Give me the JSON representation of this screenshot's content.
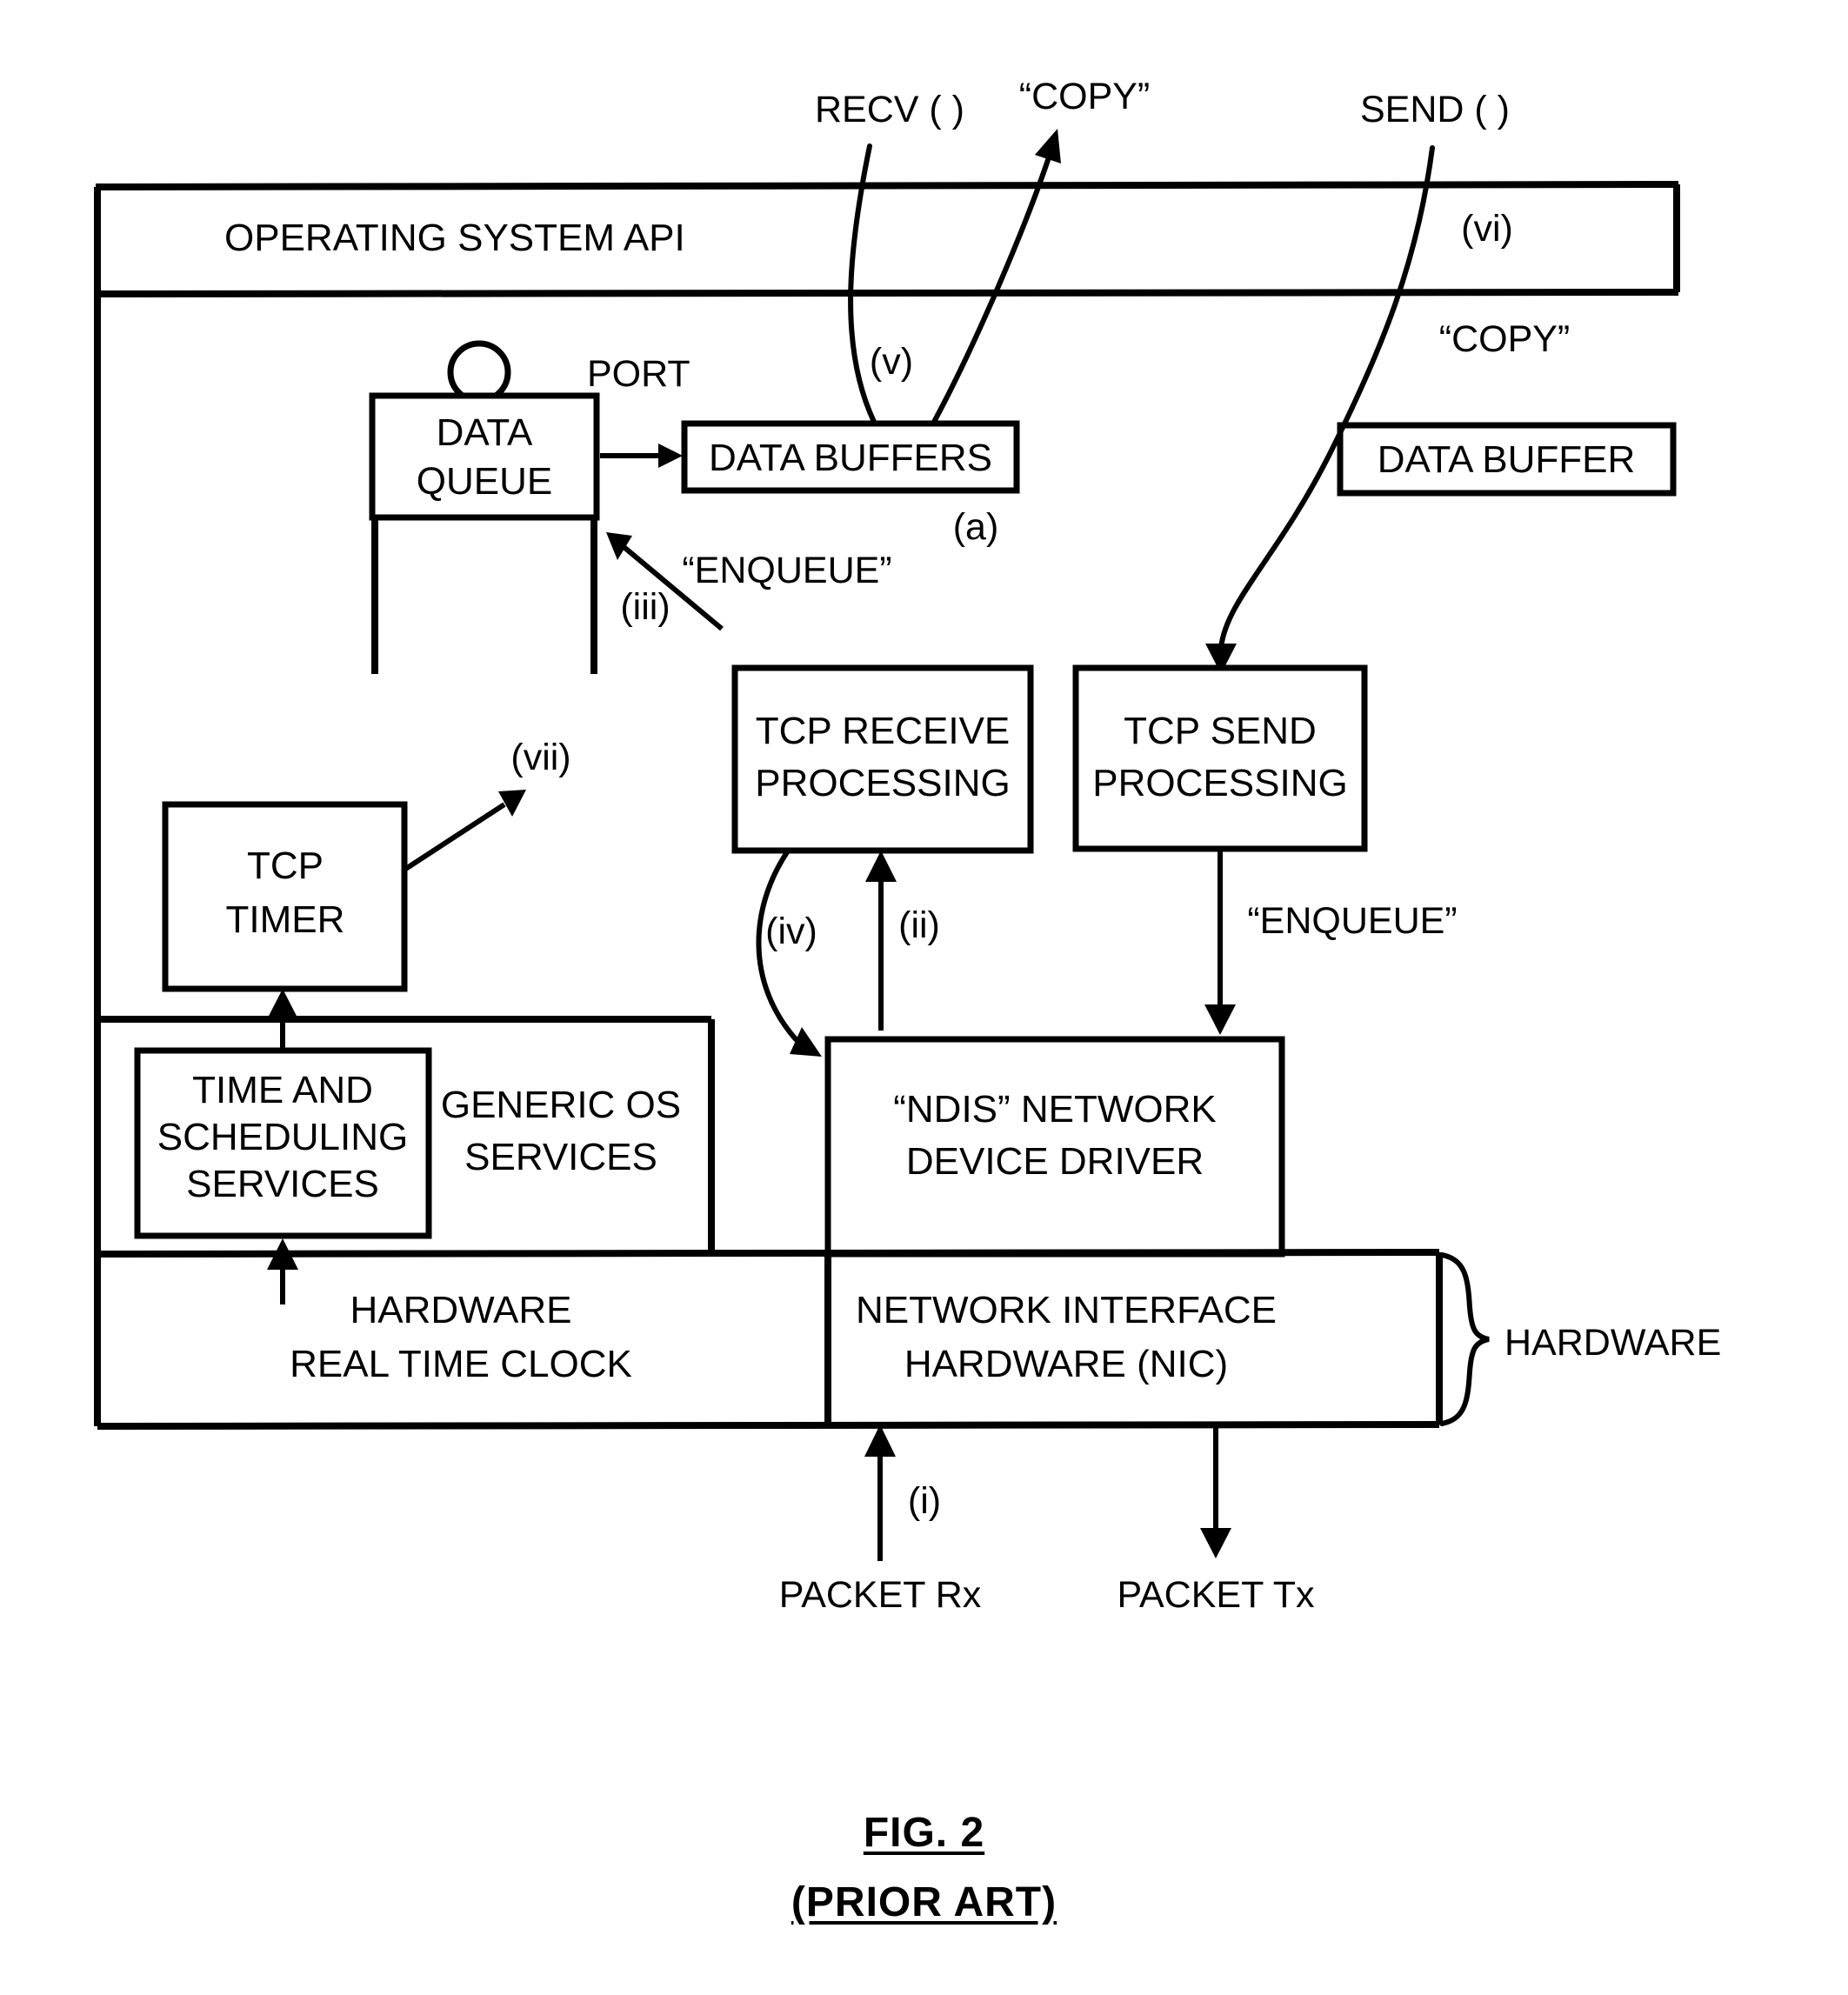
{
  "figure": {
    "number_label": "FIG. 2",
    "subtitle_label": "(PRIOR ART)"
  },
  "bands": {
    "os_api": "OPERATING SYSTEM API",
    "hardware_clock": "HARDWARE\nREAL TIME CLOCK",
    "hardware_clock_line1": "HARDWARE",
    "hardware_clock_line2": "REAL TIME CLOCK",
    "nic_line1": "NETWORK INTERFACE",
    "nic_line2": "HARDWARE (NIC)",
    "generic_os_line1": "GENERIC OS",
    "generic_os_line2": "SERVICES",
    "hardware_brace": "HARDWARE"
  },
  "boxes": {
    "data_queue_line1": "DATA",
    "data_queue_line2": "QUEUE",
    "data_buffers": "DATA BUFFERS",
    "data_buffer": "DATA BUFFER",
    "tcp_receive_line1": "TCP RECEIVE",
    "tcp_receive_line2": "PROCESSING",
    "tcp_send_line1": "TCP SEND",
    "tcp_send_line2": "PROCESSING",
    "tcp_timer_line1": "TCP",
    "tcp_timer_line2": "TIMER",
    "time_sched_line1": "TIME AND",
    "time_sched_line2": "SCHEDULING",
    "time_sched_line3": "SERVICES",
    "ndis_line1": "“NDIS” NETWORK",
    "ndis_line2": "DEVICE DRIVER"
  },
  "annotations": {
    "port": "PORT",
    "recv_call": "RECV ( )",
    "send_call": "SEND ( )",
    "copy_top": "“COPY”",
    "copy_right": "“COPY”",
    "enqueue_receive": "“ENQUEUE”",
    "enqueue_send": "“ENQUEUE”",
    "packet_rx": "PACKET Rx",
    "packet_tx": "PACKET Tx",
    "ref_a": "(a)"
  },
  "step_markers": {
    "i": "(i)",
    "ii": "(ii)",
    "iii": "(iii)",
    "iv": "(iv)",
    "v": "(v)",
    "vi": "(vi)",
    "vii": "(vii)"
  },
  "colors": {
    "ink": "#000000",
    "paper": "#ffffff"
  }
}
